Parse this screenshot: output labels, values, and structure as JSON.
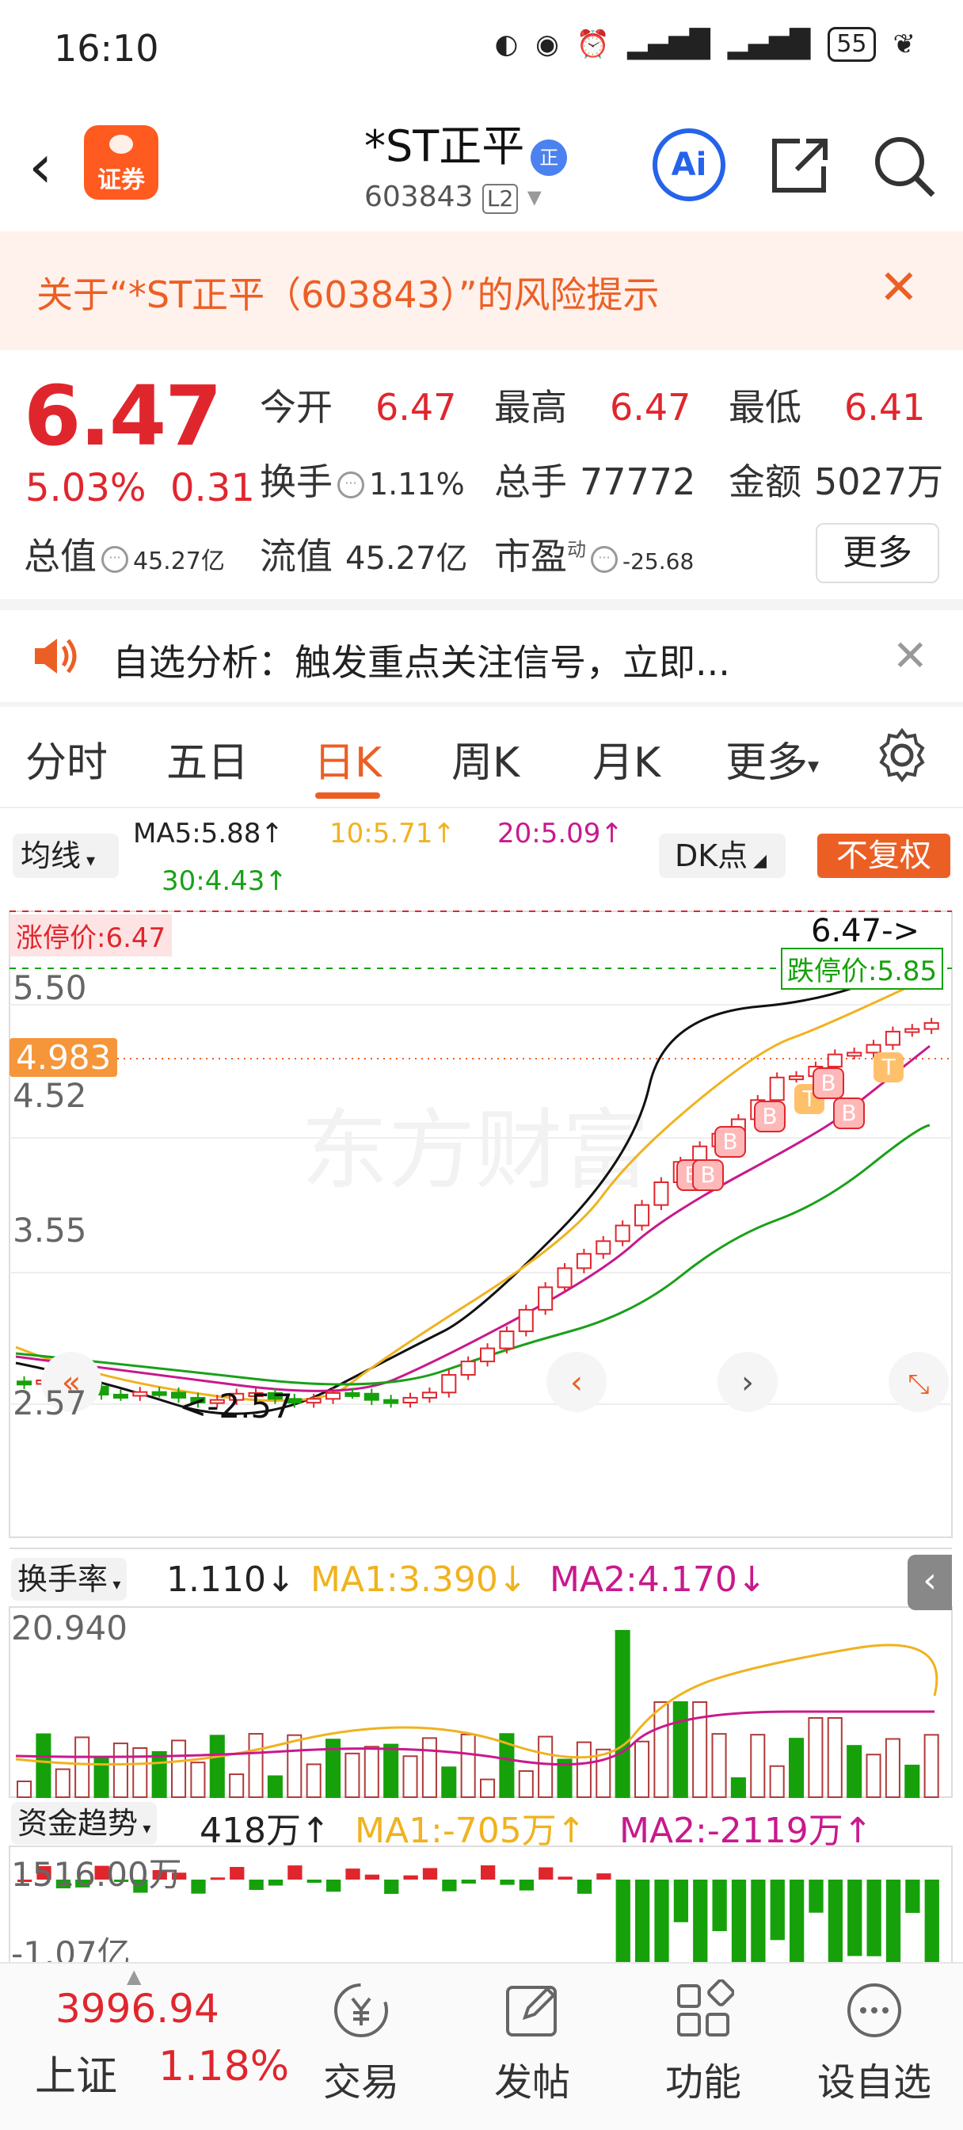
{
  "status_bar": {
    "time": "16:10",
    "battery": "55"
  },
  "header": {
    "stock_name": "*ST正平",
    "badge": "正",
    "code": "603843",
    "level": "L2",
    "logo_text": "证券",
    "ai_label": "Ai"
  },
  "risk_banner": {
    "text": "关于“*ST正平（603843）”的风险提示"
  },
  "quote": {
    "price": "6.47",
    "change_pct": "5.03%",
    "change_amt": "0.31",
    "open_label": "今开",
    "open": "6.47",
    "high_label": "最高",
    "high": "6.47",
    "low_label": "最低",
    "low": "6.41",
    "turnover_label": "换手",
    "turnover": "1.11%",
    "volume_label": "总手",
    "volume": "77772",
    "amount_label": "金额",
    "amount": "5027万",
    "mktcap_label": "总值",
    "mktcap": "45.27亿",
    "float_label": "流值",
    "float_cap": "45.27亿",
    "pe_label": "市盈",
    "pe_sup": "动",
    "pe": "-25.68",
    "more": "更多"
  },
  "analysis": {
    "text": "自选分析：触发重点关注信号，立即..."
  },
  "tabs": [
    "分时",
    "五日",
    "日K",
    "周K",
    "月K",
    "更多"
  ],
  "indicators": {
    "junxian": "均线",
    "ma5": "MA5:5.88↑",
    "ma10": "10:5.71↑",
    "ma20": "20:5.09↑",
    "ma30": "30:4.43↑",
    "dk": "DK点",
    "nofu": "不复权"
  },
  "chart_labels": {
    "limit_up": "涨停价:6.47",
    "limit_down": "跌停价:5.85",
    "top_price": "6.47->",
    "y1": "5.50",
    "y_current": "4.983",
    "y2": "4.52",
    "y3": "3.55",
    "y4": "2.57",
    "low_mark": "<-2.57",
    "watermark": "东方财富"
  },
  "turnover_panel": {
    "label": "换手率",
    "value": "1.110↓",
    "ma1": "MA1:3.390↓",
    "ma2": "MA2:4.170↓",
    "ymax": "20.940"
  },
  "fund_panel": {
    "label": "资金趋势",
    "value": "418万↑",
    "ma1": "MA1:-705万↑",
    "ma2": "MA2:-2119万↑",
    "ymax": "1516.00万",
    "ymin": "-1.07亿"
  },
  "colors": {
    "up": "#e0262d",
    "down": "#16a10a",
    "accent": "#ec5f24",
    "ma5": "#111111",
    "ma10": "#f0b21e",
    "ma20": "#c8198c",
    "ma30": "#1aa019"
  },
  "bottom_nav": {
    "index_value": "3996.94",
    "index_name": "上证",
    "index_change": "1.18%",
    "items": [
      "交易",
      "发帖",
      "功能",
      "设自选"
    ]
  }
}
